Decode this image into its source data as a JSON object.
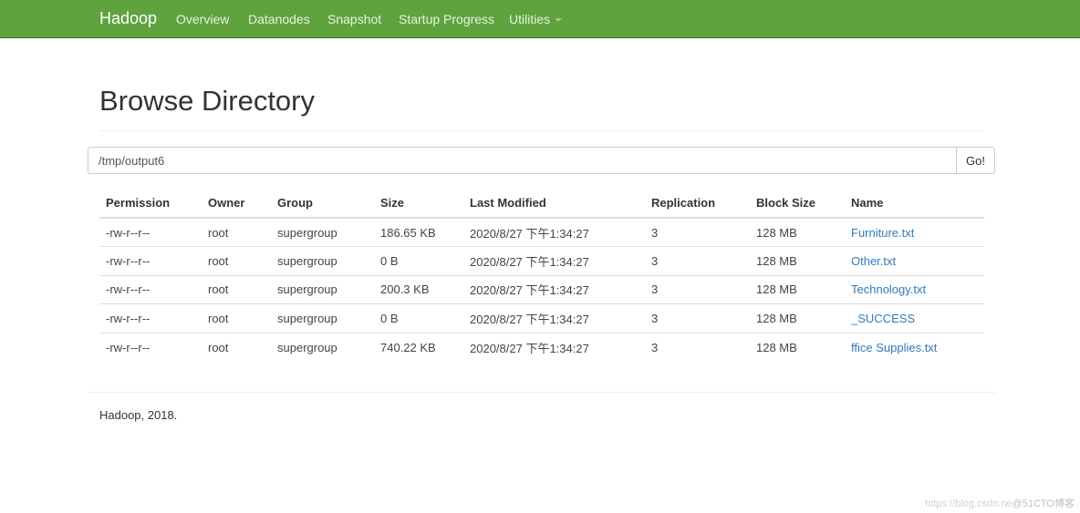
{
  "navbar": {
    "brand": "Hadoop",
    "items": [
      {
        "label": "Overview"
      },
      {
        "label": "Datanodes"
      },
      {
        "label": "Snapshot"
      },
      {
        "label": "Startup Progress"
      },
      {
        "label": "Utilities",
        "has_dropdown": true
      }
    ],
    "color": "#5fa33e"
  },
  "page": {
    "title": "Browse Directory"
  },
  "path_bar": {
    "value": "/tmp/output6",
    "go_label": "Go!"
  },
  "table": {
    "headers": [
      "Permission",
      "Owner",
      "Group",
      "Size",
      "Last Modified",
      "Replication",
      "Block Size",
      "Name"
    ],
    "rows": [
      {
        "permission": "-rw-r--r--",
        "owner": "root",
        "group": "supergroup",
        "size": "186.65 KB",
        "modified": "2020/8/27 下午1:34:27",
        "replication": "3",
        "block_size": "128 MB",
        "name": "Furniture.txt"
      },
      {
        "permission": "-rw-r--r--",
        "owner": "root",
        "group": "supergroup",
        "size": "0 B",
        "modified": "2020/8/27 下午1:34:27",
        "replication": "3",
        "block_size": "128 MB",
        "name": "Other.txt"
      },
      {
        "permission": "-rw-r--r--",
        "owner": "root",
        "group": "supergroup",
        "size": "200.3 KB",
        "modified": "2020/8/27 下午1:34:27",
        "replication": "3",
        "block_size": "128 MB",
        "name": "Technology.txt"
      },
      {
        "permission": "-rw-r--r--",
        "owner": "root",
        "group": "supergroup",
        "size": "0 B",
        "modified": "2020/8/27 下午1:34:27",
        "replication": "3",
        "block_size": "128 MB",
        "name": "_SUCCESS"
      },
      {
        "permission": "-rw-r--r--",
        "owner": "root",
        "group": "supergroup",
        "size": "740.22 KB",
        "modified": "2020/8/27 下午1:34:27",
        "replication": "3",
        "block_size": "128 MB",
        "name": "ffice Supplies.txt"
      }
    ]
  },
  "footer": {
    "text": "Hadoop, 2018."
  },
  "watermark": {
    "url": "https://blog.csdn.ne",
    "tag": "@51CTO博客"
  }
}
